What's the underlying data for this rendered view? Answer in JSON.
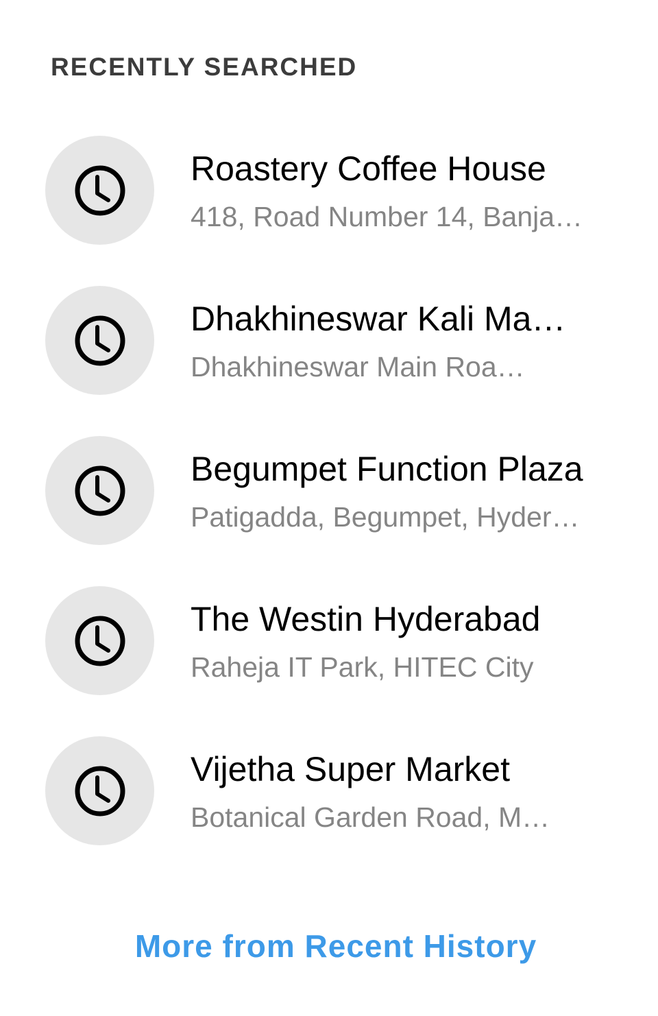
{
  "section": {
    "title": "RECENTLY SEARCHED"
  },
  "recent_items": [
    {
      "title": "Roastery Coffee House",
      "subtitle": "418, Road Number 14, Banja…",
      "icon": "clock-icon"
    },
    {
      "title": "Dhakhineswar Kali Ma…",
      "subtitle": "Dhakhineswar Main Roa…",
      "icon": "clock-icon"
    },
    {
      "title": "Begumpet Function Plaza",
      "subtitle": "Patigadda, Begumpet, Hyder…",
      "icon": "clock-icon"
    },
    {
      "title": "The Westin Hyderabad",
      "subtitle": "Raheja IT Park, HITEC City",
      "icon": "clock-icon"
    },
    {
      "title": "Vijetha Super Market",
      "subtitle": "Botanical Garden Road, M…",
      "icon": "clock-icon"
    }
  ],
  "footer": {
    "more_label": "More from Recent History"
  },
  "colors": {
    "header_text": "#3c3c3c",
    "title_text": "#000000",
    "subtitle_text": "#858585",
    "icon_circle": "#e6e6e6",
    "link": "#3d9ae8"
  }
}
